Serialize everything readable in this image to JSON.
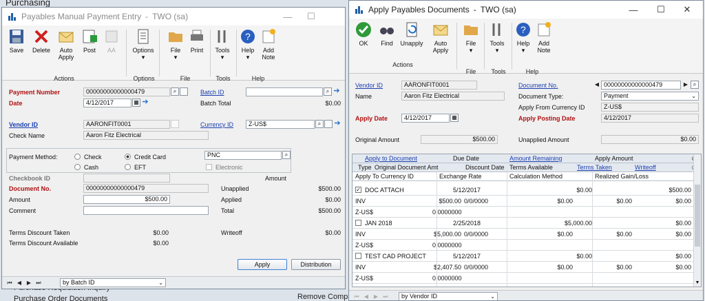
{
  "background": {
    "top_text": "Purchasing",
    "items": [
      "Purchase Requisition Inquiry",
      "Purchase Order Documents",
      "Remove Comp"
    ]
  },
  "left_window": {
    "title": "Payables Manual Payment Entry",
    "title_suffix": "TWO (sa)",
    "ribbon": {
      "buttons": {
        "save": "Save",
        "delete": "Delete",
        "auto_apply_1": "Auto",
        "auto_apply_2": "Apply",
        "post": "Post",
        "aa": "AA",
        "options": "Options",
        "file": "File",
        "print": "Print",
        "tools": "Tools",
        "help": "Help",
        "add_note_1": "Add",
        "add_note_2": "Note"
      },
      "groups": {
        "actions": "Actions",
        "options": "Options",
        "file": "File",
        "tools": "Tools",
        "help": "Help"
      }
    },
    "payment_number_label": "Payment Number",
    "payment_number": "00000000000000479",
    "date_label": "Date",
    "date": "4/12/2017",
    "batch_id_label": "Batch ID",
    "batch_id": "",
    "batch_total_label": "Batch Total",
    "batch_total": "$0.00",
    "vendor_id_label": "Vendor ID",
    "vendor_id": "AARONFIT0001",
    "check_name_label": "Check Name",
    "check_name": "Aaron Fitz Electrical",
    "currency_id_label": "Currency ID",
    "currency_id": "Z-US$",
    "payment_method_label": "Payment Method:",
    "pm_check": "Check",
    "pm_cash": "Cash",
    "pm_credit_card": "Credit Card",
    "pm_eft": "EFT",
    "card_name": "PNC",
    "electronic_label": "Electronic",
    "checkbook_id_label": "Checkbook ID",
    "checkbook_id": "",
    "amount_col_label": "Amount",
    "document_no_label": "Document No.",
    "document_no": "00000000000000479",
    "amount_label": "Amount",
    "amount": "$500.00",
    "comment_label": "Comment",
    "comment": "",
    "unapplied_label": "Unapplied",
    "unapplied": "$500.00",
    "applied_label": "Applied",
    "applied": "$0.00",
    "total_label": "Total",
    "total": "$500.00",
    "terms_taken_label": "Terms Discount Taken",
    "terms_taken": "$0.00",
    "terms_available_label": "Terms Discount Available",
    "terms_available": "$0.00",
    "writeoff_label": "Writeoff",
    "writeoff": "$0.00",
    "apply_button": "Apply",
    "distribution_button": "Distribution",
    "sort_by": "by Batch ID"
  },
  "right_window": {
    "title": "Apply Payables Documents",
    "title_suffix": "TWO (sa)",
    "ribbon": {
      "buttons": {
        "ok": "OK",
        "find": "Find",
        "unapply": "Unapply",
        "auto_apply_1": "Auto",
        "auto_apply_2": "Apply",
        "file": "File",
        "tools": "Tools",
        "help": "Help",
        "add_note_1": "Add",
        "add_note_2": "Note"
      },
      "groups": {
        "actions": "Actions",
        "file": "File",
        "tools": "Tools",
        "help": "Help"
      }
    },
    "vendor_id_label": "Vendor ID",
    "vendor_id": "AARONFIT0001",
    "name_label": "Name",
    "name": "Aaron Fitz Electrical",
    "document_no_label": "Document No.",
    "document_no": "00000000000000479",
    "document_type_label": "Document Type:",
    "document_type": "Payment",
    "apply_from_currency_label": "Apply From Currency ID",
    "apply_from_currency": "Z-US$",
    "apply_date_label": "Apply Date",
    "apply_date": "4/12/2017",
    "apply_posting_date_label": "Apply Posting Date",
    "apply_posting_date": "4/12/2017",
    "original_amount_label": "Original Amount",
    "original_amount": "$500.00",
    "unapplied_amount_label": "Unapplied Amount",
    "unapplied_amount": "$0.00",
    "grid_headers": {
      "apply_to_document": "Apply to Document",
      "due_date": "Due Date",
      "amount_remaining": "Amount Remaining",
      "apply_amount": "Apply Amount",
      "type": "Type",
      "original_document_amt": "Original Document Amt",
      "discount_date": "Discount Date",
      "terms_available": "Terms Available",
      "terms_taken": "Terms Taken",
      "writeoff": "Writeoff",
      "apply_to_currency_id": "Apply To Currency ID",
      "exchange_rate": "Exchange Rate",
      "calculation_method": "Calculation Method",
      "realized_gain_loss": "Realized Gain/Loss"
    },
    "documents": [
      {
        "checked": "✓",
        "doc": "DOC ATTACH",
        "due": "5/12/2017",
        "remaining": "$0.00",
        "apply": "$500.00",
        "type": "INV",
        "orig": "$500.00",
        "disc_date": "0/0/0000",
        "terms_avail": "$0.00",
        "terms_taken": "$0.00",
        "writeoff": "$0.00",
        "currency": "Z-US$",
        "rate": "0.0000000"
      },
      {
        "checked": "",
        "doc": "JAN 2018",
        "due": "2/25/2018",
        "remaining": "$5,000.00",
        "apply": "$0.00",
        "type": "INV",
        "orig": "$5,000.00",
        "disc_date": "0/0/0000",
        "terms_avail": "$0.00",
        "terms_taken": "$0.00",
        "writeoff": "$0.00",
        "currency": "Z-US$",
        "rate": "0.0000000"
      },
      {
        "checked": "",
        "doc": "TEST CAD PROJECT",
        "due": "5/12/2017",
        "remaining": "$0.00",
        "apply": "$0.00",
        "type": "INV",
        "orig": "$2,407.50",
        "disc_date": "0/0/0000",
        "terms_avail": "$0.00",
        "terms_taken": "$0.00",
        "writeoff": "$0.00",
        "currency": "Z-US$",
        "rate": "0.0000000"
      }
    ],
    "sort_by": "by Vendor ID"
  },
  "colors": {
    "required_label": "#b01010",
    "link": "#1a3fb0",
    "accent": "#1f6fc8"
  }
}
